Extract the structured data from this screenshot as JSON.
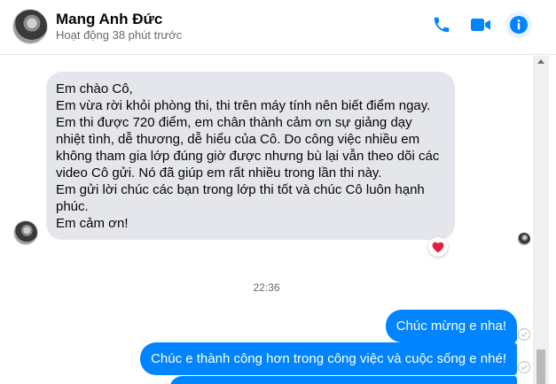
{
  "header": {
    "name": "Mang Anh Đức",
    "status": "Hoạt động 38 phút trước",
    "icons": [
      "phone-icon",
      "video-camera-icon",
      "info-icon"
    ],
    "accent_color": "#0084ff"
  },
  "messages": {
    "incoming": {
      "lines": [
        "Em chào Cô,",
        "Em vừa rời khỏi phòng thi, thi trên máy tính nên biết điểm ngay.",
        "Em thi được 720 điểm, em chân thành cảm ơn sự giảng dạy nhiệt tình, dễ thương, dễ hiểu của Cô. Do công việc nhiều em không tham gia lớp đúng giờ được nhưng bù lại vẫn theo dõi các video Cô gửi. Nó đã giúp em rất nhiều trong lần thi này.",
        "Em gửi lời chúc các bạn trong lớp thi tốt và chúc Cô luôn hạnh phúc.",
        "Em cảm ơn!"
      ],
      "reaction": "heart-icon",
      "bubble_color": "#e4e6eb"
    },
    "timestamp": "22:36",
    "outgoing": [
      {
        "text": "Chúc mừng e nha!"
      },
      {
        "text": "Chúc e thành công hơn trong công việc và cuộc sống e nhé!"
      },
      {
        "text": ""
      }
    ]
  }
}
